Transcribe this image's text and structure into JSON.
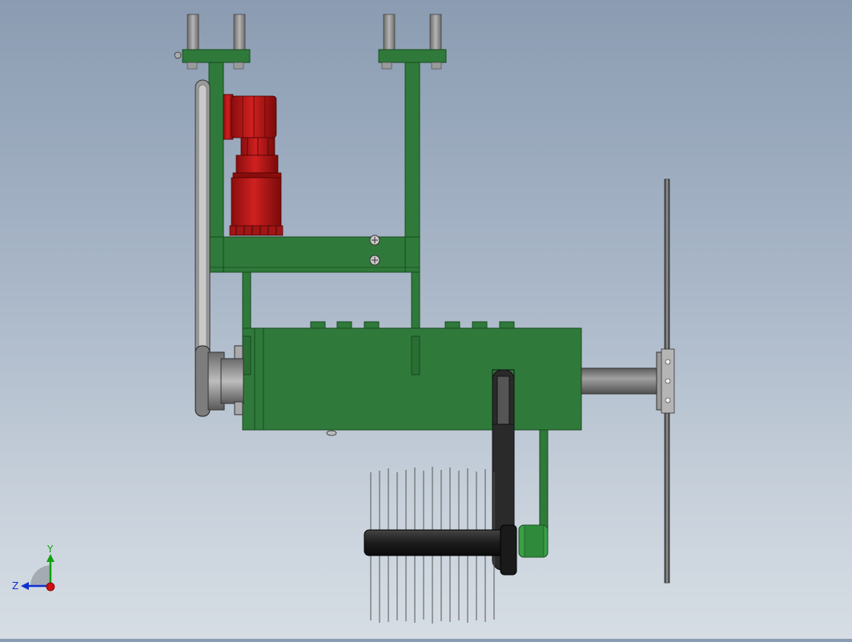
{
  "viewport": {
    "background_top": "#8b9cb2",
    "background_bottom": "#d6dde4"
  },
  "colors": {
    "frame_green": "#2f7a3a",
    "frame_green_dark": "#1f5a28",
    "motor_red": "#c01818",
    "motor_red_dark": "#7a0c0c",
    "belt_grey": "#8c8c8c",
    "shaft_grey": "#7a7a7a",
    "roller_black": "#222222",
    "axis_x": "#d01010",
    "axis_y": "#10a010",
    "axis_z": "#1030d0"
  },
  "triad": {
    "y_label": "Y",
    "z_label": "Z"
  }
}
